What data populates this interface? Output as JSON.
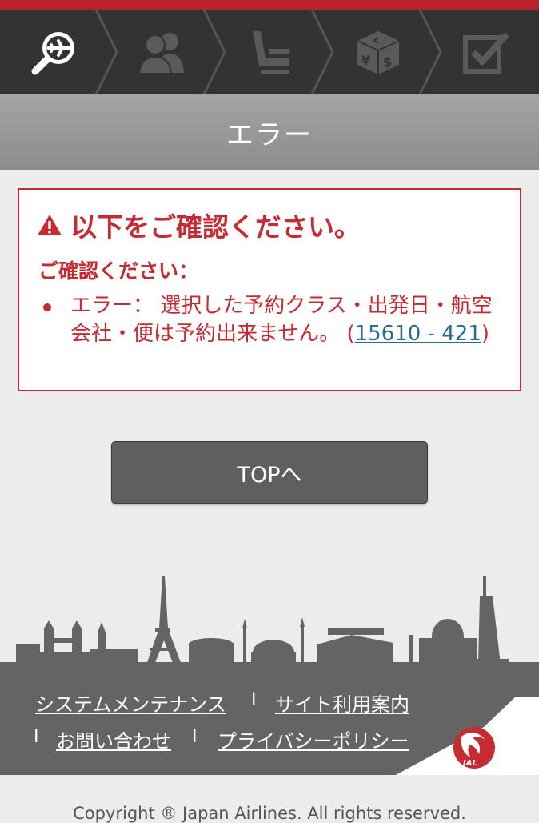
{
  "steps": [
    {
      "icon": "flight-search-icon",
      "active": true
    },
    {
      "icon": "passengers-icon",
      "active": false
    },
    {
      "icon": "seat-icon",
      "active": false
    },
    {
      "icon": "payment-icon",
      "active": false
    },
    {
      "icon": "confirm-check-icon",
      "active": false
    }
  ],
  "page": {
    "title": "エラー"
  },
  "error": {
    "heading": "以下をご確認ください。",
    "subheading": "ご確認ください：",
    "message": "エラー： 選択した予約クラス・出発日・航空会社・便は予約出来ません。 (",
    "code_link": "15610 - 421",
    "message_end": ")"
  },
  "buttons": {
    "top": "TOPへ"
  },
  "footer": {
    "links": [
      "システムメンテナンス",
      "サイト利用案内",
      "お問い合わせ",
      "プライバシーポリシー"
    ],
    "separator": "I",
    "copyright": "Copyright ® Japan Airlines. All rights reserved."
  },
  "colors": {
    "brand_red": "#c62a32",
    "nav_dark": "#333333",
    "footer_gray": "#646464"
  }
}
